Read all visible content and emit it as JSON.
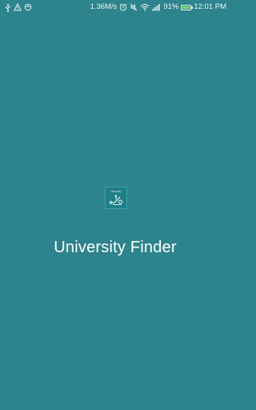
{
  "status_bar": {
    "left_icons": [
      "usb-icon",
      "warning-icon",
      "sync-icon"
    ],
    "network_speed": "1.36M/s",
    "right_icons": [
      "alarm-icon",
      "mute-icon",
      "wifi-icon",
      "signal-icon"
    ],
    "battery_percent_text": "91%",
    "battery_level": 0.91,
    "time": "12:01 PM"
  },
  "splash": {
    "app_icon": {
      "name": "app-logo-icon",
      "label": "University",
      "background": "#1f7f86"
    },
    "title": "University Finder"
  },
  "colors": {
    "background": "#2e848d",
    "text": "#ffffff",
    "battery_fill": "#7ee06a"
  }
}
